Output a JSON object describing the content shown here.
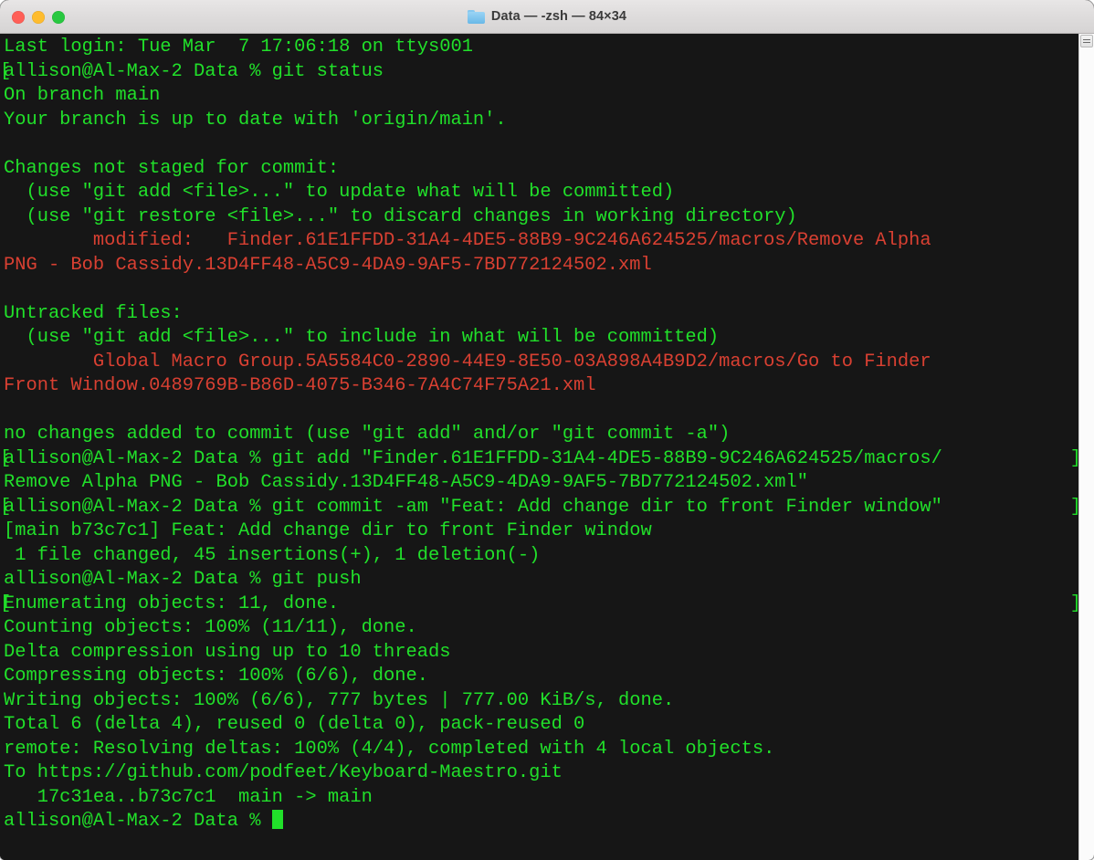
{
  "window": {
    "title": "Data — -zsh — 84×34",
    "folder_icon": "folder-icon",
    "traffic_lights": {
      "close": "close-button",
      "minimize": "minimize-button",
      "maximize": "maximize-button"
    },
    "colors": {
      "foreground_green": "#21e02a",
      "foreground_red": "#d94032",
      "background": "#161616",
      "titlebar": "#dedcdc",
      "close": "#ff5f57",
      "minimize": "#febc2e",
      "maximize": "#28c840"
    },
    "columns": 84,
    "rows": 34
  },
  "terminal": {
    "prompt": "allison@Al-Max-2 Data % ",
    "cursor": "block-cursor",
    "lines": [
      {
        "text": "Last login: Tue Mar  7 17:06:18 on ttys001",
        "color": "green"
      },
      {
        "text": "allison@Al-Max-2 Data % git status",
        "color": "green",
        "wrap_left": "["
      },
      {
        "text": "On branch main",
        "color": "green"
      },
      {
        "text": "Your branch is up to date with 'origin/main'.",
        "color": "green"
      },
      {
        "text": "",
        "color": "green"
      },
      {
        "text": "Changes not staged for commit:",
        "color": "green"
      },
      {
        "text": "  (use \"git add <file>...\" to update what will be committed)",
        "color": "green"
      },
      {
        "text": "  (use \"git restore <file>...\" to discard changes in working directory)",
        "color": "green"
      },
      {
        "text": "        modified:   Finder.61E1FFDD-31A4-4DE5-88B9-9C246A624525/macros/Remove Alpha",
        "color": "red"
      },
      {
        "text": "PNG - Bob Cassidy.13D4FF48-A5C9-4DA9-9AF5-7BD772124502.xml",
        "color": "red"
      },
      {
        "text": "",
        "color": "green"
      },
      {
        "text": "Untracked files:",
        "color": "green"
      },
      {
        "text": "  (use \"git add <file>...\" to include in what will be committed)",
        "color": "green"
      },
      {
        "text": "        Global Macro Group.5A5584C0-2890-44E9-8E50-03A898A4B9D2/macros/Go to Finder",
        "color": "red"
      },
      {
        "text": "Front Window.0489769B-B86D-4075-B346-7A4C74F75A21.xml",
        "color": "red"
      },
      {
        "text": "",
        "color": "green"
      },
      {
        "text": "no changes added to commit (use \"git add\" and/or \"git commit -a\")",
        "color": "green"
      },
      {
        "text": "allison@Al-Max-2 Data % git add \"Finder.61E1FFDD-31A4-4DE5-88B9-9C246A624525/macros/",
        "color": "green",
        "wrap_left": "[",
        "wrap_right": "]"
      },
      {
        "text": "Remove Alpha PNG - Bob Cassidy.13D4FF48-A5C9-4DA9-9AF5-7BD772124502.xml\"",
        "color": "green"
      },
      {
        "text": "allison@Al-Max-2 Data % git commit -am \"Feat: Add change dir to front Finder window\"",
        "color": "green",
        "wrap_left": "[",
        "wrap_right": "]"
      },
      {
        "text": "[main b73c7c1] Feat: Add change dir to front Finder window",
        "color": "green"
      },
      {
        "text": " 1 file changed, 45 insertions(+), 1 deletion(-)",
        "color": "green"
      },
      {
        "text": "allison@Al-Max-2 Data % git push",
        "color": "green"
      },
      {
        "text": "Enumerating objects: 11, done.",
        "color": "green",
        "wrap_left": "[",
        "wrap_right": "]"
      },
      {
        "text": "Counting objects: 100% (11/11), done.",
        "color": "green"
      },
      {
        "text": "Delta compression using up to 10 threads",
        "color": "green"
      },
      {
        "text": "Compressing objects: 100% (6/6), done.",
        "color": "green"
      },
      {
        "text": "Writing objects: 100% (6/6), 777 bytes | 777.00 KiB/s, done.",
        "color": "green"
      },
      {
        "text": "Total 6 (delta 4), reused 0 (delta 0), pack-reused 0",
        "color": "green"
      },
      {
        "text": "remote: Resolving deltas: 100% (4/4), completed with 4 local objects.",
        "color": "green"
      },
      {
        "text": "To https://github.com/podfeet/Keyboard-Maestro.git",
        "color": "green"
      },
      {
        "text": "   17c31ea..b73c7c1  main -> main",
        "color": "green"
      },
      {
        "text": "allison@Al-Max-2 Data % ",
        "color": "green",
        "cursor": true
      }
    ]
  },
  "scrollbar": {
    "grip": "scroll-grip"
  }
}
